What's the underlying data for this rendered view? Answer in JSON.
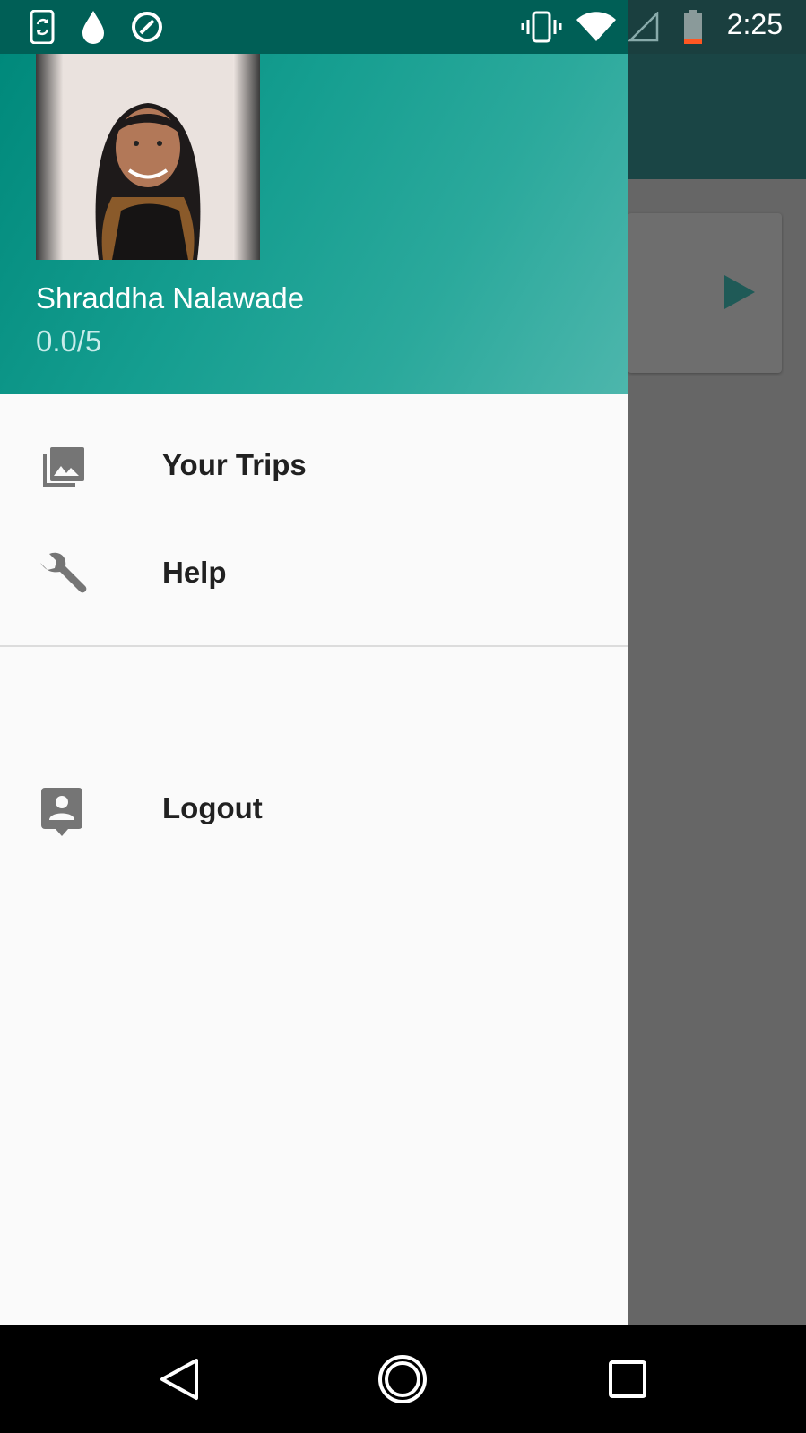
{
  "status_bar": {
    "time": "2:25",
    "icons": [
      "screen-rotation-icon",
      "water-drop-icon",
      "do-not-disturb-icon",
      "vibrate-icon",
      "wifi-icon",
      "cellular-signal-icon",
      "battery-icon"
    ]
  },
  "drawer": {
    "header": {
      "user_name": "Shraddha Nalawade",
      "rating": "0.0/5"
    },
    "menu": [
      {
        "label": "Your Trips",
        "icon": "photo-library-icon"
      },
      {
        "label": "Help",
        "icon": "wrench-icon"
      },
      {
        "label": "Logout",
        "icon": "account-box-icon"
      }
    ]
  },
  "nav_bar": {
    "buttons": [
      "back-icon",
      "home-icon",
      "recents-icon"
    ]
  },
  "colors": {
    "primary": "#00897b",
    "status_bar": "#005f56",
    "icon_gray": "#757575"
  }
}
